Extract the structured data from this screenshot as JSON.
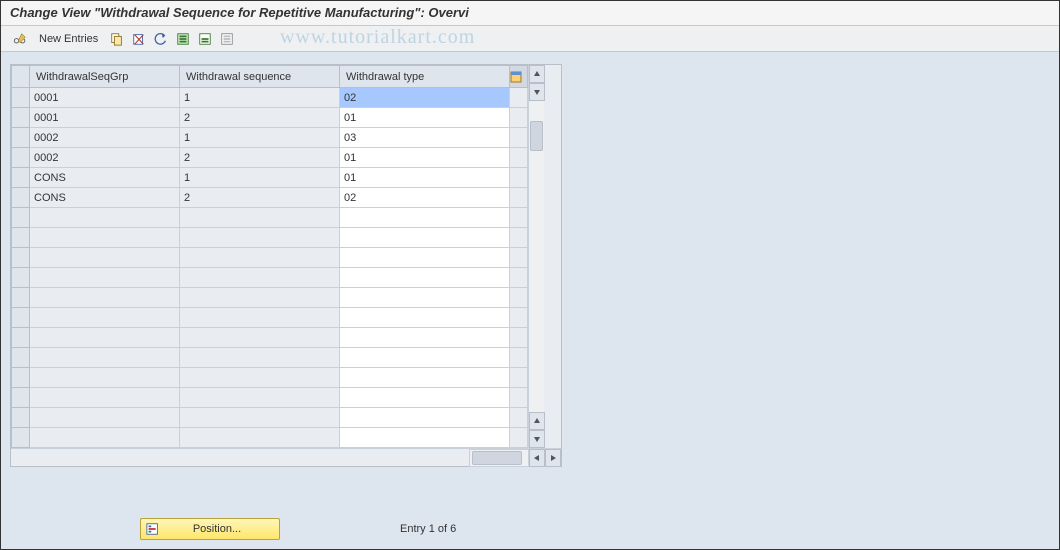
{
  "title": "Change View \"Withdrawal Sequence for Repetitive Manufacturing\": Overvi",
  "toolbar": {
    "new_entries_label": "New Entries"
  },
  "watermark": "www.tutorialkart.com",
  "table": {
    "columns": {
      "seq_grp": "WithdrawalSeqGrp",
      "sequence": "Withdrawal sequence",
      "type": "Withdrawal type"
    },
    "rows": [
      {
        "seq_grp": "0001",
        "sequence": "1",
        "type": "02",
        "selected": true
      },
      {
        "seq_grp": "0001",
        "sequence": "2",
        "type": "01",
        "selected": false
      },
      {
        "seq_grp": "0002",
        "sequence": "1",
        "type": "03",
        "selected": false
      },
      {
        "seq_grp": "0002",
        "sequence": "2",
        "type": "01",
        "selected": false
      },
      {
        "seq_grp": "CONS",
        "sequence": "1",
        "type": "01",
        "selected": false
      },
      {
        "seq_grp": "CONS",
        "sequence": "2",
        "type": "02",
        "selected": false
      }
    ],
    "blank_rows": 12
  },
  "footer": {
    "position_label": "Position...",
    "entry_label": "Entry 1 of 6"
  },
  "colors": {
    "header_bg": "#dfe5ec",
    "content_bg": "#dde5ef",
    "readonly_bg": "#e9edf2"
  }
}
